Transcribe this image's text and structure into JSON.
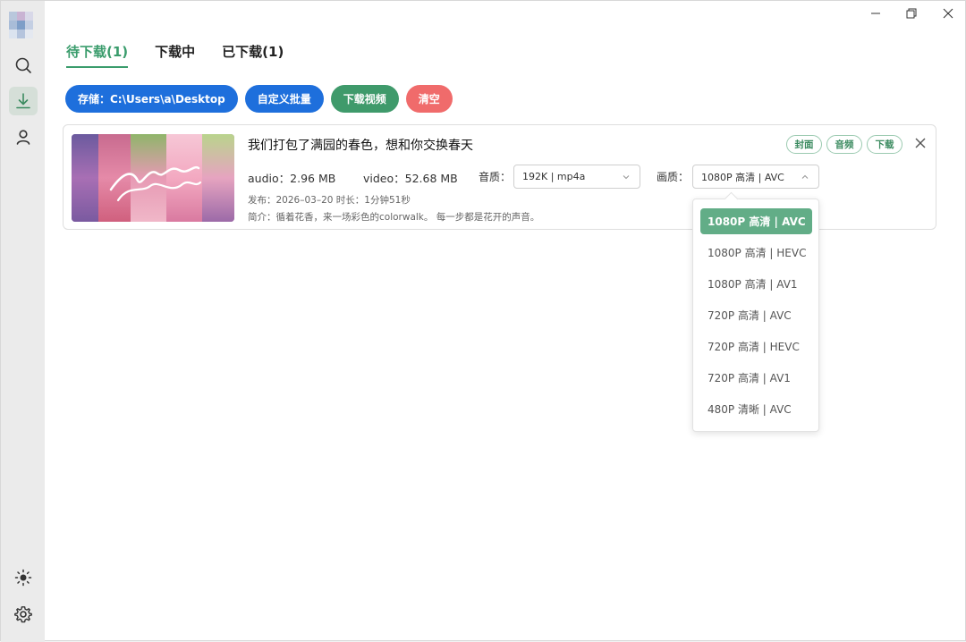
{
  "window": {
    "controls": [
      "minimize",
      "restore",
      "close"
    ]
  },
  "sidebar": {
    "items": [
      {
        "name": "search",
        "icon": "search-icon"
      },
      {
        "name": "download",
        "icon": "download-icon",
        "active": true
      },
      {
        "name": "user",
        "icon": "user-icon"
      }
    ],
    "bottom": [
      {
        "name": "theme",
        "icon": "sun-icon"
      },
      {
        "name": "settings",
        "icon": "gear-icon"
      }
    ]
  },
  "tabs": [
    {
      "label": "待下载(1)",
      "active": true
    },
    {
      "label": "下载中"
    },
    {
      "label": "已下载(1)"
    }
  ],
  "actions": {
    "storage": "存储：C:\\Users\\a\\Desktop",
    "batch": "自定义批量",
    "download_video": "下载视频",
    "clear": "清空"
  },
  "video": {
    "title": "我们打包了满园的春色，想和你交换春天",
    "audio_size": "audio：2.96 MB",
    "video_size": "video：52.68 MB",
    "audio_quality_label": "音质：",
    "audio_quality_value": "192K | mp4a",
    "video_quality_label": "画质：",
    "video_quality_value": "1080P 高清 | AVC",
    "publish_info": "发布：2026–03–20 时长：1分钟51秒",
    "description": "简介：循着花香，来一场彩色的colorwalk。 每一步都是花开的声音。",
    "tags": {
      "cover": "封面",
      "audio": "音频",
      "download": "下载"
    }
  },
  "quality_options": [
    {
      "label": "1080P 高清 | AVC",
      "selected": true
    },
    {
      "label": "1080P 高清 | HEVC"
    },
    {
      "label": "1080P 高清 | AV1"
    },
    {
      "label": "720P 高清 | AVC"
    },
    {
      "label": "720P 高清 | HEVC"
    },
    {
      "label": "720P 高清 | AV1"
    },
    {
      "label": "480P 清晰 | AVC"
    }
  ],
  "colors": {
    "accent_green": "#3a9c6c",
    "button_blue": "#1e6fdc",
    "button_red": "#f06b6b"
  }
}
